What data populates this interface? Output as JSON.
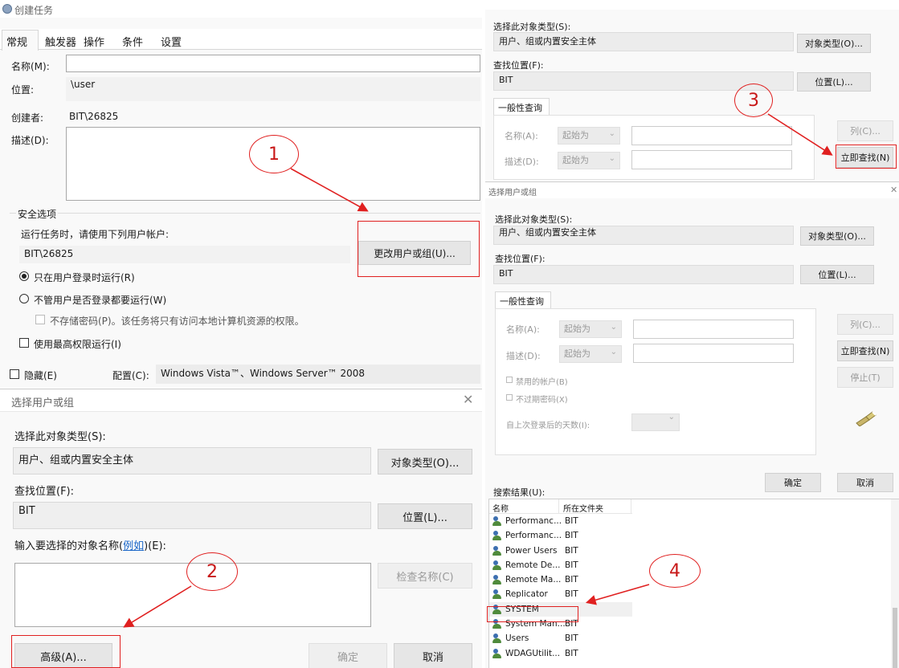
{
  "task": {
    "title": "创建任务",
    "tabs": [
      "常规",
      "触发器",
      "操作",
      "条件",
      "设置"
    ],
    "name_label": "名称(M):",
    "location_label": "位置:",
    "location_value": "\\user",
    "author_label": "创建者:",
    "author_value": "BIT\\26825",
    "desc_label": "描述(D):",
    "security_title": "安全选项",
    "run_as_label": "运行任务时，请使用下列用户帐户:",
    "run_as_value": "BIT\\26825",
    "change_user_btn": "更改用户或组(U)...",
    "radio1": "只在用户登录时运行(R)",
    "radio2": "不管用户是否登录都要运行(W)",
    "no_store_pwd": "不存储密码(P)。该任务将只有访问本地计算机资源的权限。",
    "highest_priv": "使用最高权限运行(I)",
    "hidden_label": "隐藏(E)",
    "config_label": "配置(C):",
    "config_value": "Windows Vista™、Windows Server™ 2008"
  },
  "select_small": {
    "title": "选择用户或组",
    "obj_type_label": "选择此对象类型(S):",
    "obj_type_value": "用户、组或内置安全主体",
    "obj_type_btn": "对象类型(O)...",
    "location_label": "查找位置(F):",
    "location_value": "BIT",
    "location_btn": "位置(L)...",
    "enter_label_pre": "输入要选择的对象名称(",
    "enter_label_link": "例如",
    "enter_label_post": ")(E):",
    "check_btn": "检查名称(C)",
    "advanced_btn": "高级(A)...",
    "ok_btn": "确定",
    "cancel_btn": "取消"
  },
  "select_top": {
    "obj_type_label": "选择此对象类型(S):",
    "obj_type_value": "用户、组或内置安全主体",
    "obj_type_btn": "对象类型(O)...",
    "location_label": "查找位置(F):",
    "location_value": "BIT",
    "location_btn": "位置(L)...",
    "common_tab": "一般性查询",
    "name_label": "名称(A):",
    "desc_label": "描述(D):",
    "starts_with": "起始为",
    "columns_btn": "列(C)...",
    "find_now_btn": "立即查找(N)"
  },
  "select_adv": {
    "title": "选择用户或组",
    "obj_type_label": "选择此对象类型(S):",
    "obj_type_value": "用户、组或内置安全主体",
    "obj_type_btn": "对象类型(O)...",
    "location_label": "查找位置(F):",
    "location_value": "BIT",
    "location_btn": "位置(L)...",
    "common_tab": "一般性查询",
    "name_label": "名称(A):",
    "desc_label": "描述(D):",
    "starts_with": "起始为",
    "columns_btn": "列(C)...",
    "find_now_btn": "立即查找(N)",
    "stop_btn": "停止(T)",
    "disabled_accounts": "禁用的帐户(B)",
    "no_expire_pwd": "不过期密码(X)",
    "days_since": "自上次登录后的天数(I):",
    "ok_btn": "确定",
    "cancel_btn": "取消",
    "results_label": "搜索结果(U):",
    "col_name": "名称",
    "col_folder": "所在文件夹",
    "rows": [
      {
        "name": "Performanc...",
        "folder": "BIT"
      },
      {
        "name": "Performanc...",
        "folder": "BIT"
      },
      {
        "name": "Power Users",
        "folder": "BIT"
      },
      {
        "name": "Remote De...",
        "folder": "BIT"
      },
      {
        "name": "Remote Ma...",
        "folder": "BIT"
      },
      {
        "name": "Replicator",
        "folder": "BIT"
      },
      {
        "name": "SYSTEM",
        "folder": ""
      },
      {
        "name": "System Man...",
        "folder": "BIT"
      },
      {
        "name": "Users",
        "folder": "BIT"
      },
      {
        "name": "WDAGUtilit...",
        "folder": "BIT"
      }
    ]
  },
  "annotations": [
    "1",
    "2",
    "3",
    "4"
  ]
}
